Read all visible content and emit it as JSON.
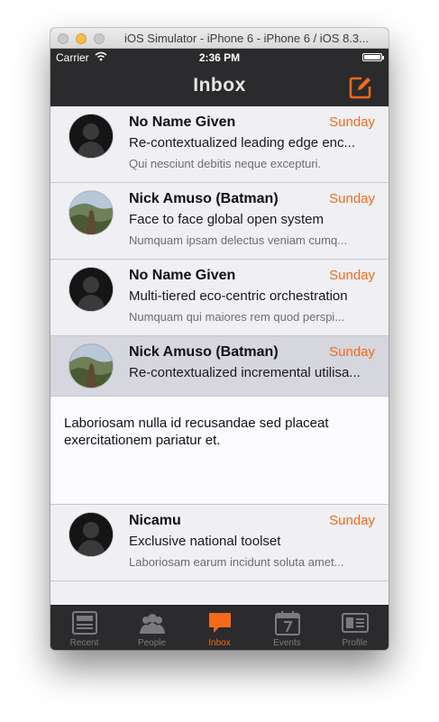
{
  "window": {
    "title": "iOS Simulator - iPhone 6 - iPhone 6 / iOS 8.3..."
  },
  "status_bar": {
    "carrier": "Carrier",
    "time": "2:36 PM"
  },
  "nav": {
    "title": "Inbox",
    "compose_icon": "compose-icon"
  },
  "messages": [
    {
      "sender": "No Name Given",
      "date": "Sunday",
      "subject": "Re-contextualized leading edge enc...",
      "preview": "Qui nesciunt debitis neque excepturi.",
      "avatar": "silhouette-avatar"
    },
    {
      "sender": "Nick Amuso (Batman)",
      "date": "Sunday",
      "subject": "Face to face global open system",
      "preview": "Numquam ipsam delectus veniam cumq...",
      "avatar": "photo-avatar"
    },
    {
      "sender": "No Name Given",
      "date": "Sunday",
      "subject": "Multi-tiered eco-centric orchestration",
      "preview": "Numquam qui maiores rem quod perspi...",
      "avatar": "silhouette-avatar"
    },
    {
      "sender": "Nick Amuso (Batman)",
      "date": "Sunday",
      "subject": "Re-contextualized incremental utilisa...",
      "body": "Laboriosam nulla id recusandae sed placeat exercitationem pariatur et.",
      "avatar": "photo-avatar",
      "selected": true
    },
    {
      "sender": "Nicamu",
      "date": "Sunday",
      "subject": "Exclusive national toolset",
      "preview": "Laboriosam earum incidunt soluta amet...",
      "avatar": "silhouette-avatar"
    }
  ],
  "tabs": [
    {
      "label": "Recent",
      "icon": "newspaper-icon",
      "active": false
    },
    {
      "label": "People",
      "icon": "people-icon",
      "active": false
    },
    {
      "label": "Inbox",
      "icon": "chat-bubble-icon",
      "active": true
    },
    {
      "label": "Events",
      "icon": "calendar-icon",
      "active": false
    },
    {
      "label": "Profile",
      "icon": "id-card-icon",
      "active": false
    }
  ],
  "colors": {
    "accent": "#f46a1a",
    "bar_background": "#2b2b2d",
    "list_background": "#efeff4",
    "selected_row": "#d6d6de"
  }
}
